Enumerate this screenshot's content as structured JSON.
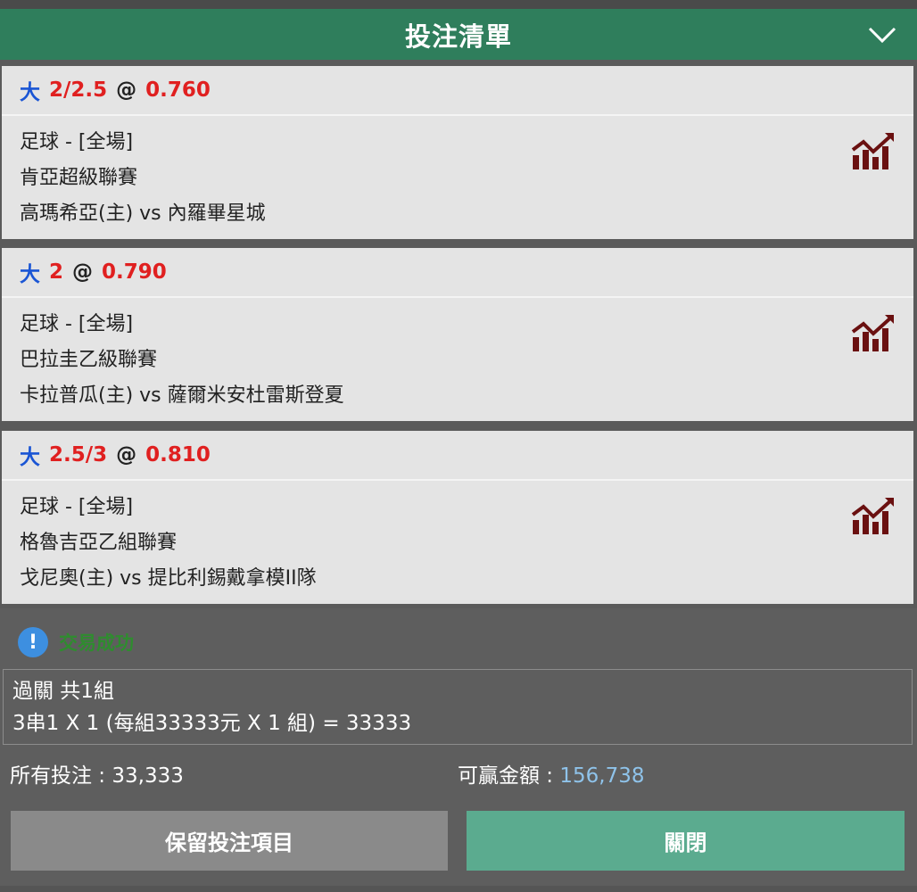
{
  "header": {
    "title": "投注清單"
  },
  "bets": [
    {
      "selection": "大",
      "line": "2/2.5",
      "at": "@",
      "odds": "0.760",
      "sport": "足球 - [全場]",
      "league": "肯亞超級聯賽",
      "match": "高瑪希亞(主) vs 內羅畢星城"
    },
    {
      "selection": "大",
      "line": "2",
      "at": "@",
      "odds": "0.790",
      "sport": "足球 - [全場]",
      "league": "巴拉圭乙級聯賽",
      "match": "卡拉普瓜(主) vs 薩爾米安杜雷斯登夏"
    },
    {
      "selection": "大",
      "line": "2.5/3",
      "at": "@",
      "odds": "0.810",
      "sport": "足球 - [全場]",
      "league": "格魯吉亞乙組聯賽",
      "match": "戈尼奧(主) vs 提比利錫戴拿模II隊"
    }
  ],
  "message": {
    "icon": "info-icon",
    "icon_glyph": "!",
    "text": "交易成功"
  },
  "summary": {
    "line1": "過關 共1組",
    "line2": "3串1 X 1 (每組33333元 X 1 組) = 33333"
  },
  "totals": {
    "stake_label": "所有投注 : ",
    "stake_value": "33,333",
    "win_label": "可贏金額 : ",
    "win_value": "156,738"
  },
  "buttons": {
    "keep_label": "保留投注項目",
    "close_label": "關閉"
  },
  "colors": {
    "header_bg": "#2f7e5c",
    "selection": "#1a55d4",
    "odds": "#e02020",
    "stats_icon": "#6a1010",
    "win_value": "#8fc3ea",
    "close_btn": "#5bab8f",
    "keep_btn": "#8a8a8a"
  }
}
